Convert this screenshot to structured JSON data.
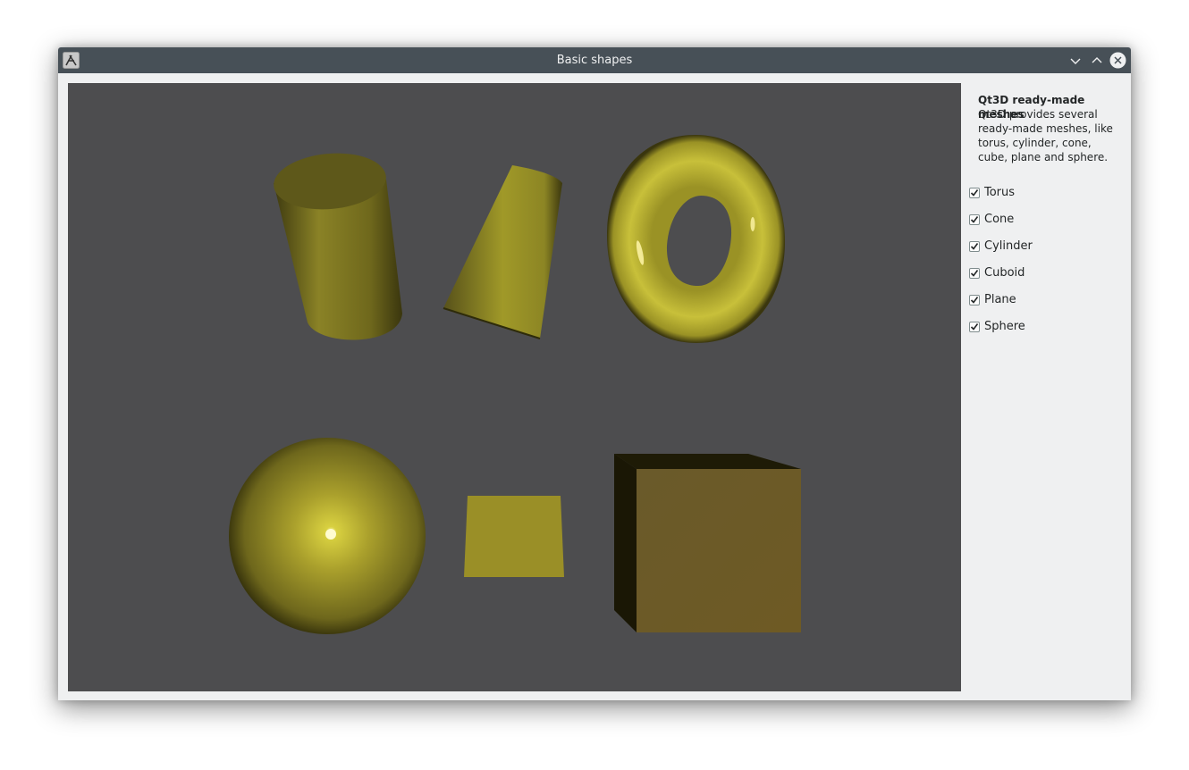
{
  "window": {
    "title": "Basic shapes",
    "icon": "qt-app-icon",
    "controls": [
      "minimize-icon",
      "maximize-icon",
      "close-icon"
    ]
  },
  "viewport": {
    "background": "#4d4d4f",
    "shape_color": "#b8b030",
    "shapes": [
      "Cylinder",
      "Cone",
      "Torus",
      "Sphere",
      "Plane",
      "Cuboid"
    ]
  },
  "sidebar": {
    "title": "Qt3D ready-made meshes",
    "description": "Qt3D provides several ready-made meshes, like torus, cylinder, cone, cube, plane and sphere.",
    "checkboxes": [
      {
        "label": "Torus",
        "checked": true
      },
      {
        "label": "Cone",
        "checked": true
      },
      {
        "label": "Cylinder",
        "checked": true
      },
      {
        "label": "Cuboid",
        "checked": true
      },
      {
        "label": "Plane",
        "checked": true
      },
      {
        "label": "Sphere",
        "checked": true
      }
    ]
  }
}
